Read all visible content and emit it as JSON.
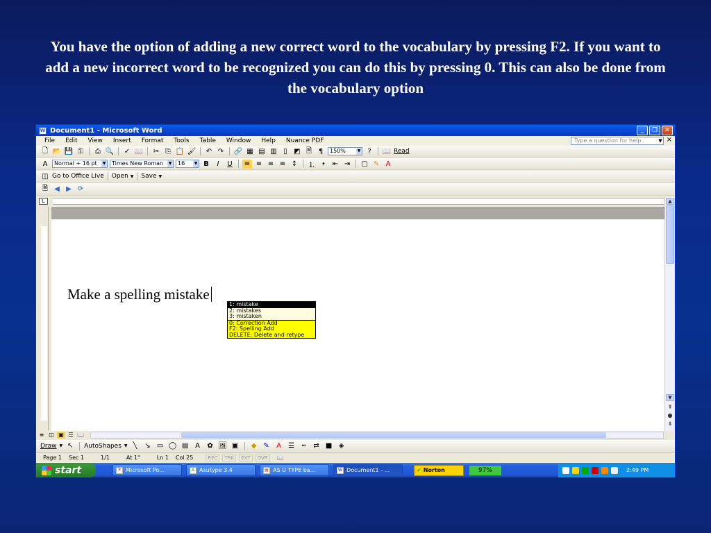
{
  "slide": {
    "caption": "You have the option of adding a new correct word to the vocabulary by pressing F2.  If you want to add a new incorrect word to be recognized you can do this by pressing 0.  This can also be done from the vocabulary option"
  },
  "window": {
    "title": "Document1 - Microsoft Word",
    "menu": [
      "File",
      "Edit",
      "View",
      "Insert",
      "Format",
      "Tools",
      "Table",
      "Window",
      "Help",
      "Nuance PDF"
    ],
    "ask_placeholder": "Type a question for help",
    "zoom": "150%",
    "read_label": "Read",
    "style": "Normal + 16 pt",
    "font": "Times New Roman",
    "font_size": "16",
    "office_live": "Go to Office Live",
    "open_label": "Open",
    "save_label": "Save"
  },
  "document": {
    "text": "Make a spelling mistake"
  },
  "correction_popup": {
    "options": [
      "1: mistake",
      "2: mistakes",
      "3: mistaken"
    ],
    "commands": [
      "0: Correction Add",
      "F2: Spelling Add",
      "DELETE: Delete and retype"
    ]
  },
  "drawing_toolbar": {
    "draw_label": "Draw",
    "autoshapes_label": "AutoShapes"
  },
  "statusbar": {
    "page": "Page 1",
    "sec": "Sec 1",
    "pages": "1/1",
    "at": "At 1\"",
    "ln": "Ln 1",
    "col": "Col 25",
    "modes": [
      "REC",
      "TRK",
      "EXT",
      "OVR"
    ]
  },
  "taskbar": {
    "start_label": "start",
    "tasks": [
      "Microsoft Po...",
      "Asutype 3.4",
      "AS U TYPE ba...",
      "Document1 - ..."
    ],
    "norton_label": "Norton",
    "battery": "97%",
    "clock": "2:49 PM"
  }
}
